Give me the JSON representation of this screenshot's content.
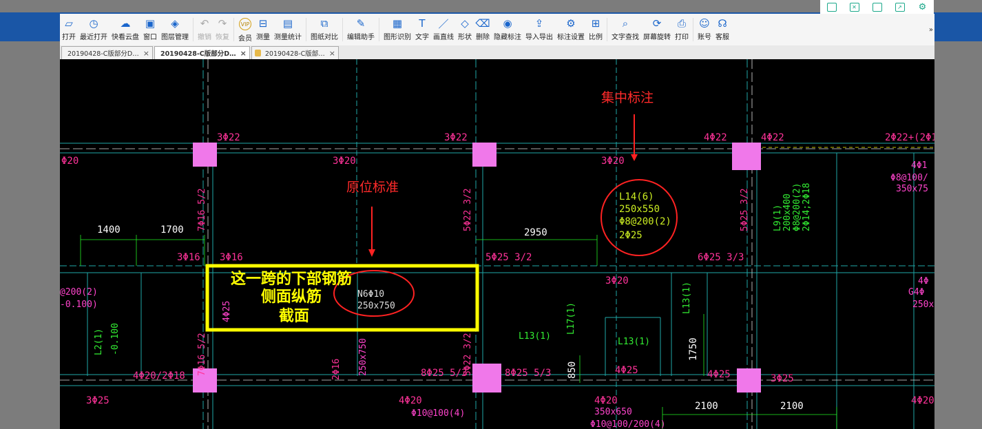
{
  "toolbar": {
    "items": [
      {
        "label": "打开",
        "icon": "folder-open-icon"
      },
      {
        "label": "最近打开",
        "icon": "clock-icon"
      },
      {
        "label": "快看云盘",
        "icon": "cloud-icon"
      },
      {
        "label": "窗口",
        "icon": "window-icon"
      },
      {
        "label": "图层管理",
        "icon": "layers-icon"
      },
      {
        "label": "撤销",
        "icon": "undo-icon"
      },
      {
        "label": "恢复",
        "icon": "redo-icon"
      },
      {
        "label": "会员",
        "icon": "vip-icon"
      },
      {
        "label": "测量",
        "icon": "measure-icon"
      },
      {
        "label": "测量统计",
        "icon": "stats-icon"
      },
      {
        "label": "图纸对比",
        "icon": "compare-icon"
      },
      {
        "label": "编辑助手",
        "icon": "edit-assistant-icon"
      },
      {
        "label": "图形识别",
        "icon": "shape-recognition-icon"
      },
      {
        "label": "文字",
        "icon": "text-icon"
      },
      {
        "label": "画直线",
        "icon": "line-icon"
      },
      {
        "label": "形状",
        "icon": "shape-icon"
      },
      {
        "label": "删除",
        "icon": "eraser-icon"
      },
      {
        "label": "隐藏标注",
        "icon": "eye-hide-icon"
      },
      {
        "label": "导入导出",
        "icon": "import-export-icon"
      },
      {
        "label": "标注设置",
        "icon": "annotation-settings-icon"
      },
      {
        "label": "比例",
        "icon": "scale-icon"
      },
      {
        "label": "文字查找",
        "icon": "text-search-icon"
      },
      {
        "label": "屏幕旋转",
        "icon": "rotate-icon"
      },
      {
        "label": "打印",
        "icon": "print-icon"
      },
      {
        "label": "账号",
        "icon": "user-icon"
      },
      {
        "label": "客服",
        "icon": "headset-icon"
      }
    ],
    "more": "»"
  },
  "tabs": [
    {
      "label": "20190428-C版部分D…",
      "close": "×"
    },
    {
      "label": "20190428-C版部分D…",
      "close": "×"
    },
    {
      "label": "20190428-C版部…",
      "close": "×"
    }
  ],
  "annotations": {
    "centralized": "集中标注",
    "in_situ": "原位标准",
    "box_line1": "这一跨的下部钢筋",
    "box_line2": "侧面纵筋",
    "box_line3": "截面"
  },
  "cad_labels": {
    "top": [
      "3Φ22",
      "3Φ22",
      "4Φ22",
      "4Φ22",
      "2Φ22+(2Φ1"
    ],
    "second": [
      "Φ20",
      "3Φ20",
      "3Φ20"
    ],
    "dims": [
      "1400",
      "1700",
      "2950",
      "850",
      "1750",
      "2100",
      "2100"
    ],
    "beam": [
      "L14(6)",
      "250x550",
      "Φ8@200(2)",
      "2Φ25"
    ],
    "n6": [
      "N6Φ10",
      "250x750"
    ],
    "misc_red": [
      "3Φ16",
      "3Φ16",
      "5Φ25 3/2",
      "6Φ25 3/3",
      "4Φ25",
      "4Φ25",
      "8Φ25 5/3",
      "8Φ25 5/3",
      "3Φ25",
      "3Φ20",
      "4Φ20/2Φ18",
      "3Φ25",
      "4Φ20",
      "4Φ20",
      "2Φ16",
      "5Φ22 3/2",
      "5Φ22 3/2",
      "7Φ16 5/2",
      "7Φ16 5/2"
    ],
    "misc_green": [
      "L9(1)",
      "200x400",
      "Φ8@200(2)",
      "2Φ14;2Φ18",
      "L13(1)",
      "L13(1)",
      "L13(1)",
      "L17(1)",
      "L2(1)",
      "Φ10@100(4)",
      "350x650",
      "Φ10@100/200(4)",
      "4Φ1",
      "Φ8@100/",
      "350x75",
      "4Φ",
      "G4Φ",
      "250x",
      "@200(2)",
      "-0.100)",
      "-0.100"
    ]
  },
  "colors": {
    "cad_bg": "#000000",
    "red_text": "#ff2a2a",
    "magenta": "#ff44cc",
    "green": "#33ee33",
    "column": "#ff88ee",
    "cyan": "#00cccc",
    "yellow": "#ffff00"
  }
}
